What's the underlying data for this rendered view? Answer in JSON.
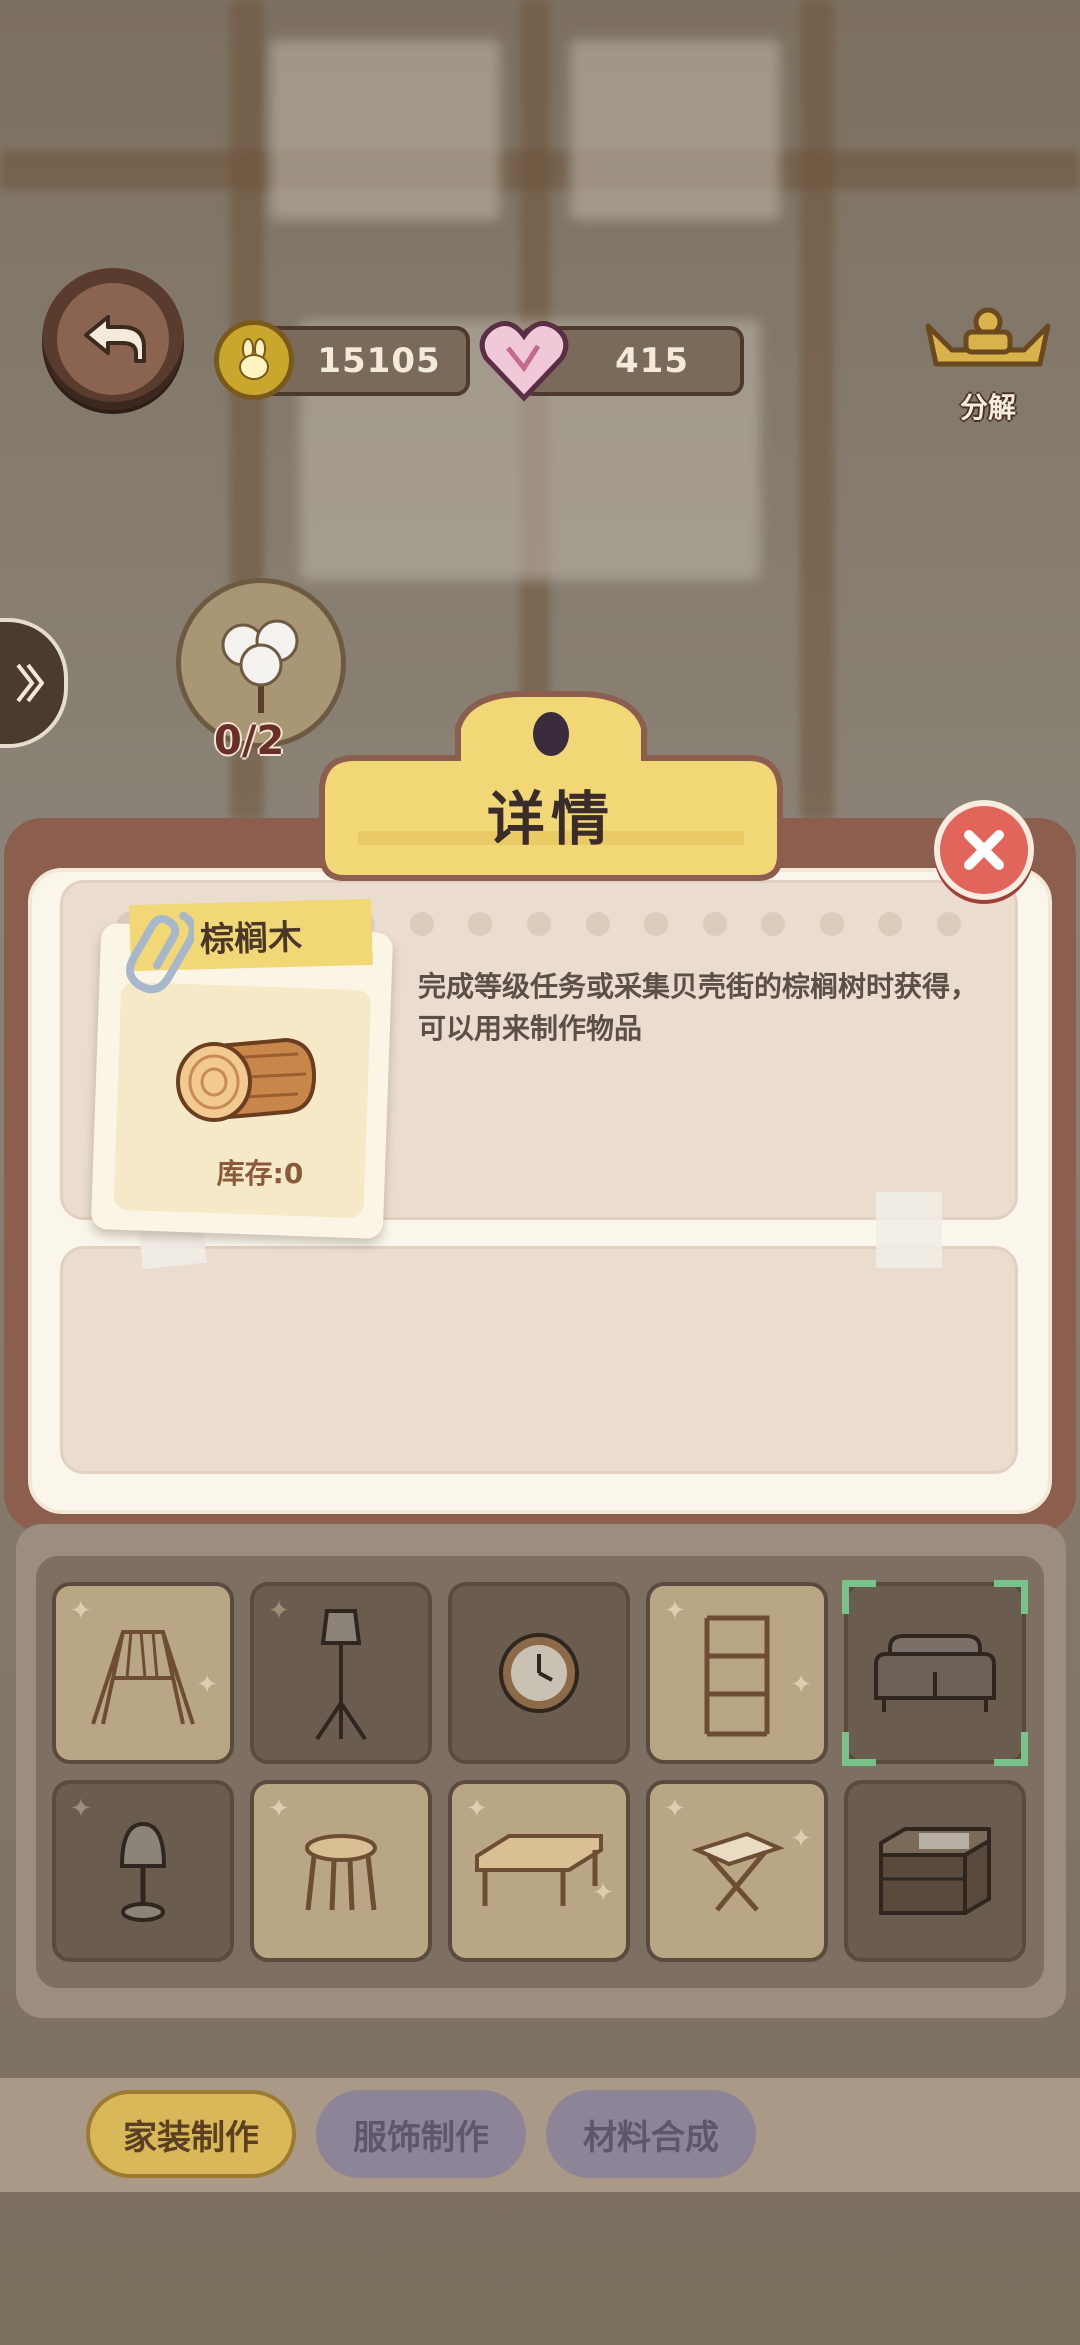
{
  "currency": {
    "coins": "15105",
    "hearts": "415"
  },
  "topbar": {
    "decompose_label": "分解"
  },
  "material_goal": {
    "count": "0/2"
  },
  "dialog": {
    "title": "详情",
    "item_name": "棕榈木",
    "stock_label": "库存:0",
    "description": "完成等级任务或采集贝壳街的棕榈树时获得，可以用来制作物品"
  },
  "furniture_slots": [
    {
      "name": "clothes-rack",
      "style": "light"
    },
    {
      "name": "floor-lamp",
      "style": "dark"
    },
    {
      "name": "wall-clock",
      "style": "dark"
    },
    {
      "name": "shelf",
      "style": "light"
    },
    {
      "name": "sofa",
      "style": "dark",
      "selected": true
    },
    {
      "name": "table-lamp",
      "style": "dark"
    },
    {
      "name": "stool",
      "style": "light"
    },
    {
      "name": "coffee-table",
      "style": "light"
    },
    {
      "name": "folding-stool",
      "style": "light"
    },
    {
      "name": "display-cabinet",
      "style": "dark"
    }
  ],
  "tabs": [
    {
      "label": "家装制作",
      "active": true
    },
    {
      "label": "服饰制作",
      "active": false
    },
    {
      "label": "材料合成",
      "active": false
    }
  ],
  "colors": {
    "accent_yellow": "#f1d776",
    "close_red": "#e1655a",
    "modal_brown": "#8b5e4e",
    "selected_green": "#79c38a"
  }
}
